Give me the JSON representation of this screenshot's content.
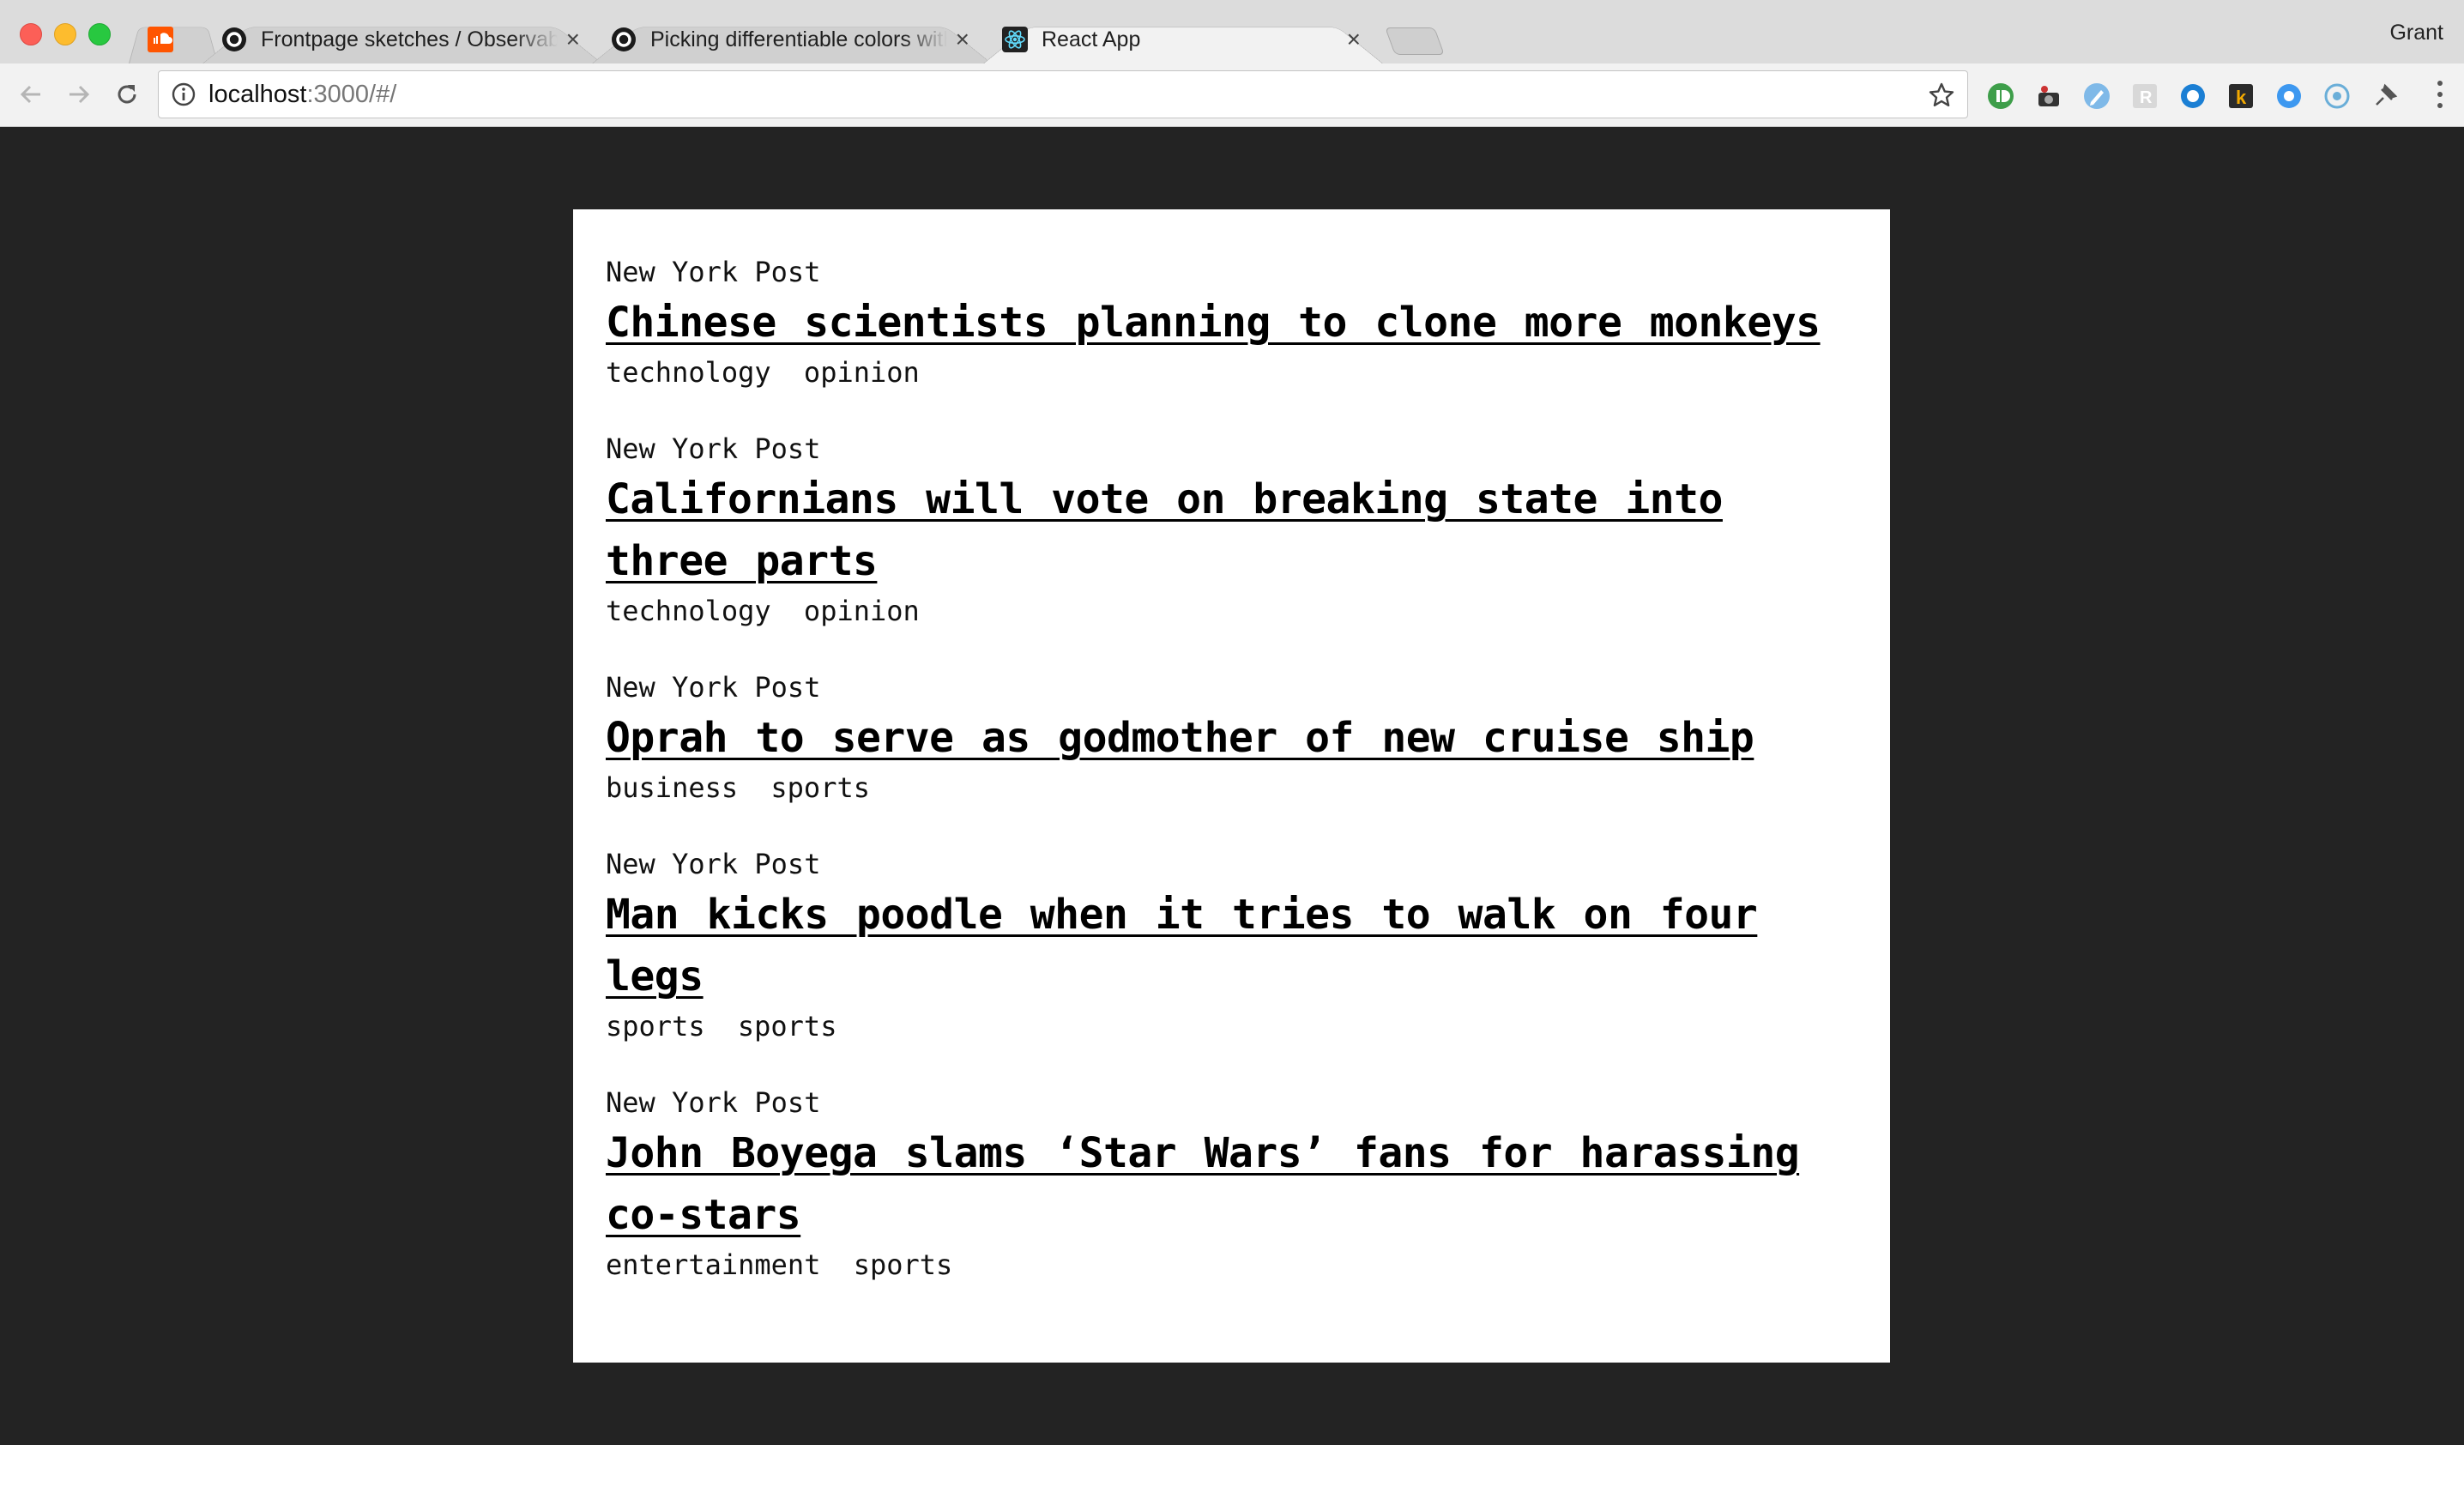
{
  "browser": {
    "tabs": [
      {
        "title": "",
        "favicon": "soundcloud-icon",
        "active": false,
        "has_close": false
      },
      {
        "title": "Frontpage sketches / Observable",
        "favicon": "observable-icon",
        "active": false,
        "has_close": true
      },
      {
        "title": "Picking differentiable colors with",
        "favicon": "observable-icon",
        "active": false,
        "has_close": true
      },
      {
        "title": "React App",
        "favicon": "react-icon",
        "active": true,
        "has_close": true
      }
    ],
    "close_glyph": "×",
    "profile_name": "Grant",
    "url_host": "localhost",
    "url_rest": ":3000/#/",
    "extensions": [
      "instapaper-icon",
      "camera-extension-icon",
      "pen-extension-icon",
      "r-extension-icon",
      "circle-blue-icon",
      "k-extension-icon",
      "circle-lightblue-icon",
      "circle-outline-icon",
      "pin-extension-icon"
    ]
  },
  "stories": [
    {
      "source": "New York Post",
      "headline": "Chinese scientists planning to clone more monkeys",
      "tags": [
        "technology",
        "opinion"
      ]
    },
    {
      "source": "New York Post",
      "headline": "Californians will vote on breaking state into three parts",
      "tags": [
        "technology",
        "opinion"
      ]
    },
    {
      "source": "New York Post",
      "headline": "Oprah to serve as godmother of new cruise ship",
      "tags": [
        "business",
        "sports"
      ]
    },
    {
      "source": "New York Post",
      "headline": "Man kicks poodle when it tries to walk on four legs",
      "tags": [
        "sports",
        "sports"
      ]
    },
    {
      "source": "New York Post",
      "headline": "John Boyega slams ‘Star Wars’ fans for harassing co-stars",
      "tags": [
        "entertainment",
        "sports"
      ]
    }
  ],
  "colors": {
    "page_background": "#232323",
    "card_background": "#ffffff",
    "headline": "#000000"
  }
}
